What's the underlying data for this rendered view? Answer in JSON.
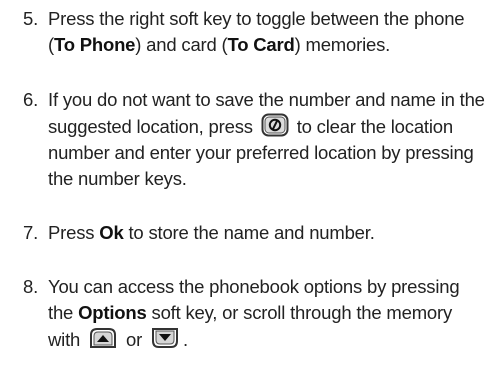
{
  "steps": [
    {
      "num": "5.",
      "text_a": "Press the right soft key to toggle between the phone (",
      "bold_a": "To Phone",
      "text_b": ") and card (",
      "bold_b": "To Card",
      "text_c": ") memories."
    },
    {
      "num": "6.",
      "text_a": "If you do not want to save the number and name in the suggested location, press",
      "icon": "clear-key-icon",
      "text_b": "to clear the location number and enter your preferred location by pressing the number keys."
    },
    {
      "num": "7.",
      "text_a": "Press",
      "bold_a": "Ok",
      "text_b": "to store the name and number."
    },
    {
      "num": "8.",
      "text_a": "You can access the phonebook options by pressing the",
      "bold_a": "Options",
      "text_b": "soft key, or scroll through the memory with",
      "icon_a": "scroll-up-key-icon",
      "text_c": "or",
      "icon_b": "scroll-down-key-icon",
      "text_d": "."
    }
  ]
}
